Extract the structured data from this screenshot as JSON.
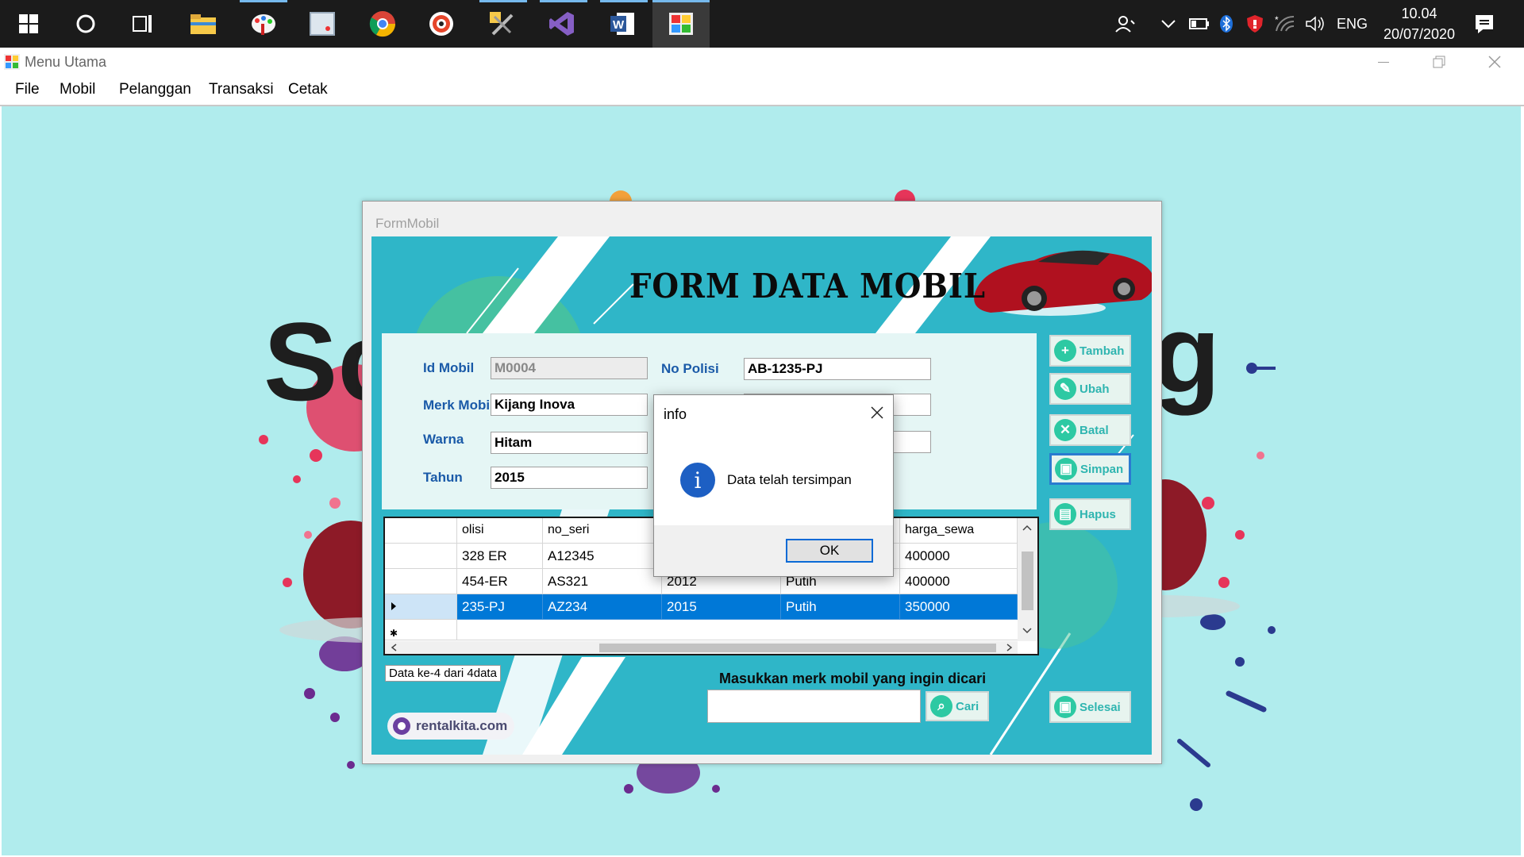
{
  "taskbar": {
    "clock_time": "10.04",
    "clock_date": "20/07/2020",
    "language": "ENG",
    "pinned_apps": [
      "start-icon",
      "cortana-icon",
      "task-view-icon",
      "file-explorer-icon",
      "paint-icon",
      "snipping-icon",
      "chrome-icon",
      "media-icon",
      "tools-icon",
      "visual-studio-icon",
      "word-icon",
      "winforms-app-icon"
    ]
  },
  "window": {
    "title": "Menu Utama",
    "menu": [
      "File",
      "Mobil",
      "Pelanggan",
      "Transaksi",
      "Cetak"
    ]
  },
  "background": {
    "big_text_left": "Sc",
    "big_text_right": "g"
  },
  "form": {
    "title": "FormMobil",
    "heading": "FORM DATA MOBIL",
    "fields": {
      "id_mobil_label": "Id Mobil",
      "id_mobil_value": "M0004",
      "merk_mobil_label": "Merk Mobil",
      "merk_mobil_value": "Kijang Inova",
      "warna_label": "Warna",
      "warna_value": "Hitam",
      "tahun_label": "Tahun",
      "tahun_value": "2015",
      "no_polisi_label": "No Polisi",
      "no_polisi_value": "AB-1235-PJ"
    },
    "buttons": {
      "tambah": "Tambah",
      "ubah": "Ubah",
      "batal": "Batal",
      "simpan": "Simpan",
      "hapus": "Hapus",
      "cari": "Cari",
      "selesai": "Selesai"
    },
    "grid": {
      "columns": [
        "olisi",
        "no_seri",
        "",
        "",
        "harga_sewa"
      ],
      "rows": [
        [
          "328 ER",
          "A12345",
          "",
          "",
          "400000"
        ],
        [
          "454-ER",
          "AS321",
          "2012",
          "Putih",
          "400000"
        ],
        [
          "235-PJ",
          "AZ234",
          "2015",
          "Putih",
          "350000"
        ]
      ]
    },
    "status": "Data ke-4 dari 4data",
    "search_label": "Masukkan merk mobil yang ingin dicari",
    "search_value": "",
    "logo_text": "rentalkita.com"
  },
  "dialog": {
    "title": "info",
    "message": "Data telah tersimpan",
    "ok": "OK"
  }
}
